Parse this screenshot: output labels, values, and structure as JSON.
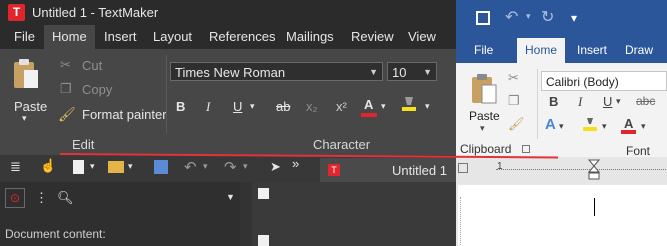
{
  "colors": {
    "textmaker_dark": "#3d3d3d",
    "textmaker_brand": "#e0252c",
    "word_brand": "#2b579a",
    "annotation_red": "#e4323a"
  },
  "textmaker": {
    "logo_letter": "T",
    "title": "Untitled 1 - TextMaker",
    "tabs": [
      "File",
      "Home",
      "Insert",
      "Layout",
      "References",
      "Mailings",
      "Review",
      "View"
    ],
    "active_tab": "Home",
    "edit_group": {
      "paste": "Paste",
      "cut": "Cut",
      "copy": "Copy",
      "format_painter": "Format painter",
      "label": "Edit"
    },
    "character_group": {
      "font": "Times New Roman",
      "size": "10",
      "bold": "B",
      "italic": "I",
      "underline": "U",
      "strike": "ab",
      "subscript": "x₂",
      "superscript": "x²",
      "font_color": "A",
      "label": "Character"
    },
    "doc_tab": "Untitled 1",
    "doc_tab_icon": "T",
    "nav_label": "Document content:"
  },
  "word": {
    "tabs": [
      "File",
      "Home",
      "Insert",
      "Draw"
    ],
    "active_tab": "Home",
    "paste": "Paste",
    "clipboard_label": "Clipboard",
    "font": "Calibri (Body)",
    "font_group_label": "Font",
    "bold": "B",
    "italic": "I",
    "underline": "U",
    "font_color": "A",
    "text_effects": "A",
    "ruler_mark": "1"
  }
}
